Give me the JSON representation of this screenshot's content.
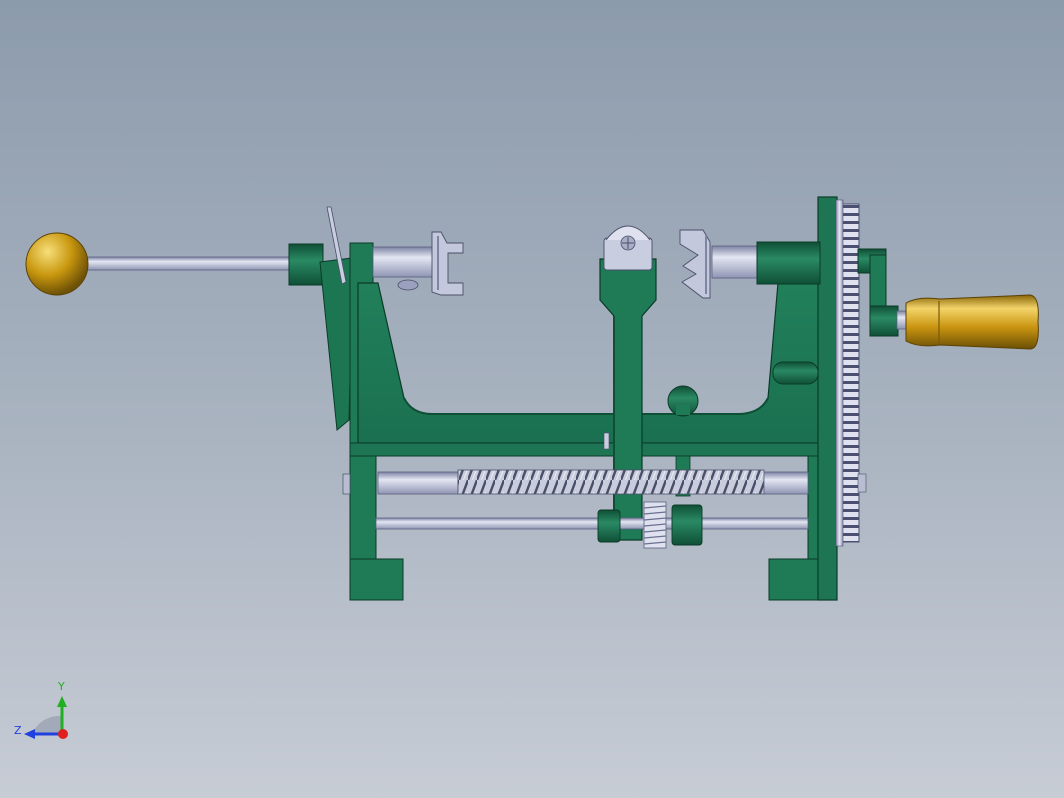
{
  "viewport": {
    "colors": {
      "frame_green": "#1f7a56",
      "frame_green_dark": "#135a3e",
      "steel": "#b9bfd6",
      "steel_dark": "#7f86a6",
      "brass": "#d8a718",
      "background_top": "#8c9bac",
      "background_bottom": "#c7ccd5"
    }
  },
  "model": {
    "parts": [
      "lever-knob-icon",
      "crank-handle-icon",
      "gear-icon",
      "lead-screw-icon",
      "spring-icon",
      "peeler-blade-icon",
      "frame-icon"
    ]
  },
  "triad": {
    "y_label": "Y",
    "z_label": "Z",
    "x_color": "#e02020",
    "y_color": "#20b020",
    "z_color": "#2040e0"
  }
}
